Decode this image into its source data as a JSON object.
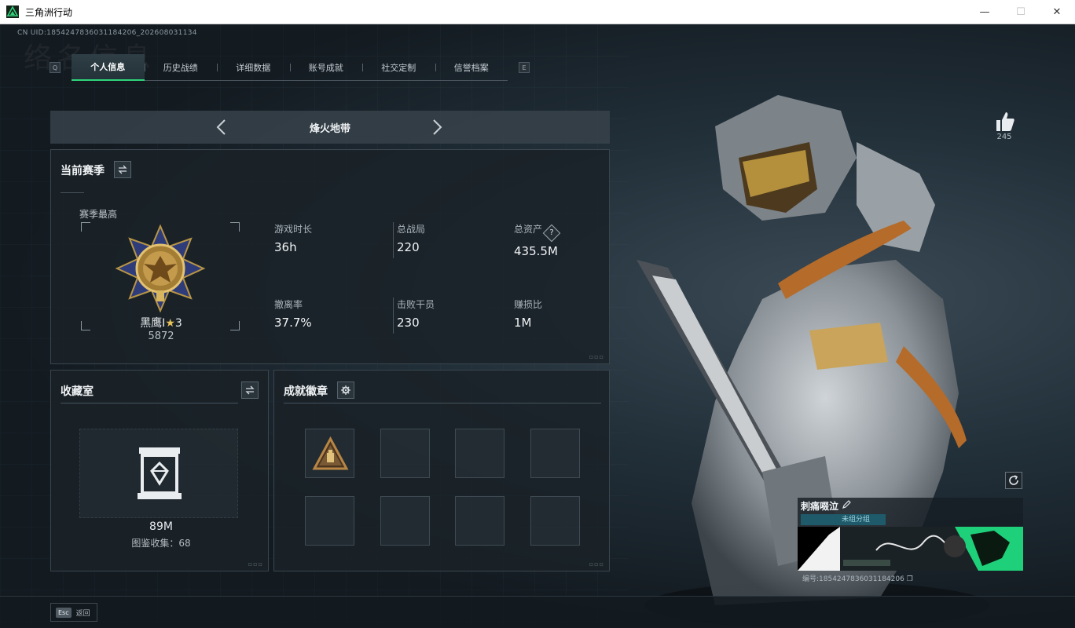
{
  "window": {
    "title": "三角洲行动",
    "controls": {
      "minimize": "—",
      "maximize": "☐",
      "close": "✕"
    }
  },
  "header": {
    "uid": "CN UID:1854247836031184206_202608031134",
    "bg_text": "络名信息"
  },
  "tabs": {
    "left_key": "Q",
    "right_key": "E",
    "items": [
      {
        "label": "个人信息",
        "active": true
      },
      {
        "label": "历史战绩",
        "active": false
      },
      {
        "label": "详细数据",
        "active": false
      },
      {
        "label": "账号成就",
        "active": false
      },
      {
        "label": "社交定制",
        "active": false
      },
      {
        "label": "信誉档案",
        "active": false
      }
    ]
  },
  "mode": {
    "label": "烽火地带"
  },
  "season": {
    "title": "当前赛季",
    "best_label": "赛季最高",
    "rank_name": "黑鹰I",
    "rank_star": "3",
    "rank_score": "5872",
    "stats": [
      {
        "label": "游戏时长",
        "value": "36h"
      },
      {
        "label": "总战局",
        "value": "220"
      },
      {
        "label": "总资产",
        "value": "435.5M",
        "help": "?"
      },
      {
        "label": "撤离率",
        "value": "37.7%"
      },
      {
        "label": "击败干员",
        "value": "230"
      },
      {
        "label": "赚损比",
        "value": "1M"
      }
    ]
  },
  "collection": {
    "title": "收藏室",
    "value": "89M",
    "count_label": "图鉴收集：",
    "count": "68"
  },
  "achievements": {
    "title": "成就徽章",
    "slots": 8
  },
  "profile": {
    "likes": "245",
    "player_name": "刺痛啜泣",
    "group_label": "未组分组",
    "card_id": "编号:1854247836031184206"
  },
  "bottom": {
    "esc_key": "Esc",
    "esc_label": "返回"
  },
  "colors": {
    "accent": "#2ed47a",
    "panel_bg": "#1a2228",
    "text": "#f0f3f5"
  }
}
